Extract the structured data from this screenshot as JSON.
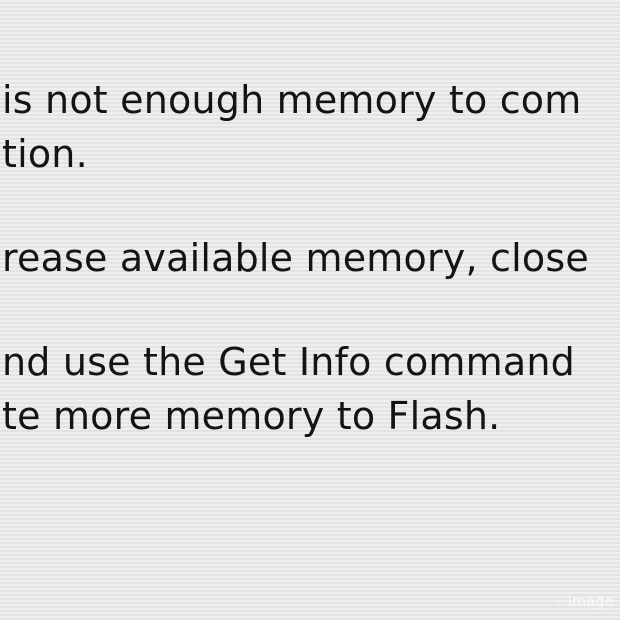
{
  "dialog": {
    "paragraphs": [
      {
        "lines": [
          "is not enough memory to com",
          "tion."
        ]
      },
      {
        "lines": [
          "rease available memory, close"
        ]
      },
      {
        "lines": [
          "nd use the Get Info command",
          "te more memory to Flash."
        ]
      }
    ]
  },
  "watermark": {
    "text": "- image"
  }
}
